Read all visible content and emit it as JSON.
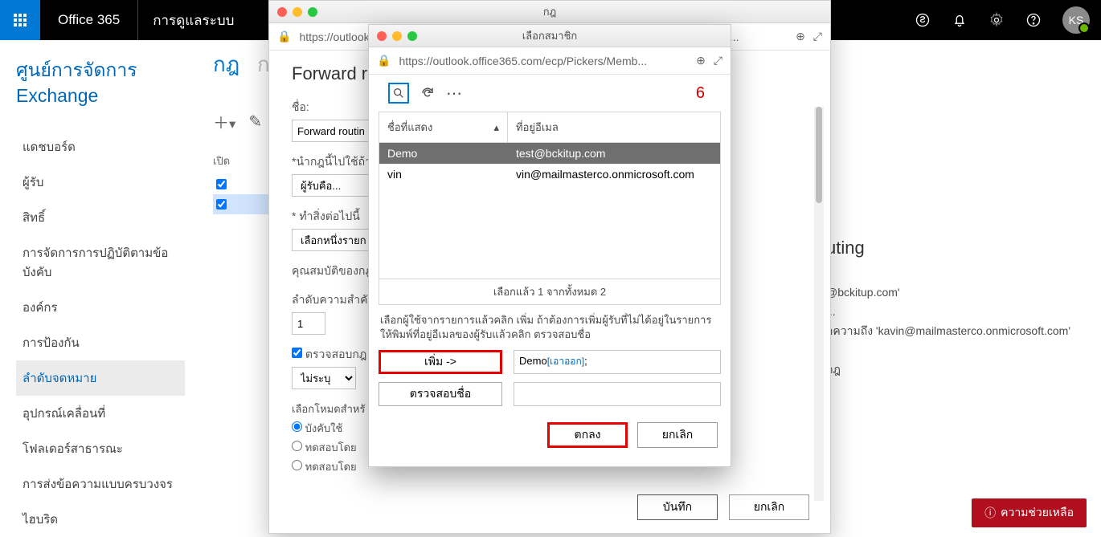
{
  "topbar": {
    "brand": "Office 365",
    "admin": "การดูแลระบบ",
    "avatar": "KS"
  },
  "page_title": "ศูนย์การจัดการ Exchange",
  "nav": {
    "dashboard": "แดชบอร์ด",
    "recipients": "ผู้รับ",
    "permissions": "สิทธิ์",
    "compliance": "การจัดการการปฏิบัติตามข้อบังคับ",
    "organization": "องค์กร",
    "protection": "การป้องกัน",
    "mailflow": "ลำดับจดหมาย",
    "mobile": "อุปกรณ์เคลื่อนที่",
    "publicfolders": "โฟลเดอร์สาธารณะ",
    "unified": "การส่งข้อความแบบครบวงจร",
    "hybrid": "ไฮบริด"
  },
  "mid": {
    "tab1": "กฎ",
    "tab2": "กา",
    "col_on": "เปิด"
  },
  "detail": {
    "title_partial": "uting",
    "line1": "@bckitup.com'",
    "line2": "...",
    "line3": "อความถึง 'kavin@mailmasterco.onmicrosoft.com'",
    "line4": "กฎ"
  },
  "modal1": {
    "win_title": "กฎ",
    "url": "https://outlook.office365.com/ecp/RulesEditor/EditTransportRule.aspx?ActivityCorrelati...",
    "heading": "Forward rout",
    "lbl_name": "ชื่อ:",
    "val_name": "Forward routin",
    "lbl_apply": "*นำกฎนี้ไปใช้ถ้า",
    "val_apply": "ผู้รับคือ...",
    "lbl_do": "* ทำสิ่งต่อไปนี้",
    "val_do": "เลือกหนึ่งรายก",
    "lbl_props": "คุณสมบัติของกฎ",
    "lbl_priority": "ลำดับความสำคั",
    "val_priority": "1",
    "chk_audit": "ตรวจสอบกฎ",
    "sel_severity": "ไม่ระบุ",
    "lbl_mode": "เลือกโหมดสำหรั",
    "r_enforce": "บังคับใช้",
    "r_test1": "ทดสอบโดย",
    "r_test2": "ทดสอบโดย",
    "btn_save": "บันทึก",
    "btn_cancel": "ยกเลิก"
  },
  "modal2": {
    "win_title": "เลือกสมาชิก",
    "url": "https://outlook.office365.com/ecp/Pickers/Memb...",
    "step": "6",
    "col_name": "ชื่อที่แสดง",
    "col_email": "ที่อยู่อีเมล",
    "rows": [
      {
        "name": "Demo",
        "email": "test@bckitup.com"
      },
      {
        "name": "vin",
        "email": "vin@mailmasterco.onmicrosoft.com"
      }
    ],
    "count": "เลือกแล้ว 1 จากทั้งหมด 2",
    "help": "เลือกผู้ใช้จากรายการแล้วคลิก เพิ่ม ถ้าต้องการเพิ่มผู้รับที่ไม่ได้อยู่ในรายการ ให้พิมพ์ที่อยู่อีเมลของผู้รับแล้วคลิก ตรวจสอบชื่อ",
    "btn_add": "เพิ่ม ->",
    "btn_check": "ตรวจสอบชื่อ",
    "added_name": "Demo",
    "added_remove": "[เอาออก]",
    "btn_ok": "ตกลง",
    "btn_cancel": "ยกเลิก"
  },
  "helpbtn": "ความช่วยเหลือ"
}
